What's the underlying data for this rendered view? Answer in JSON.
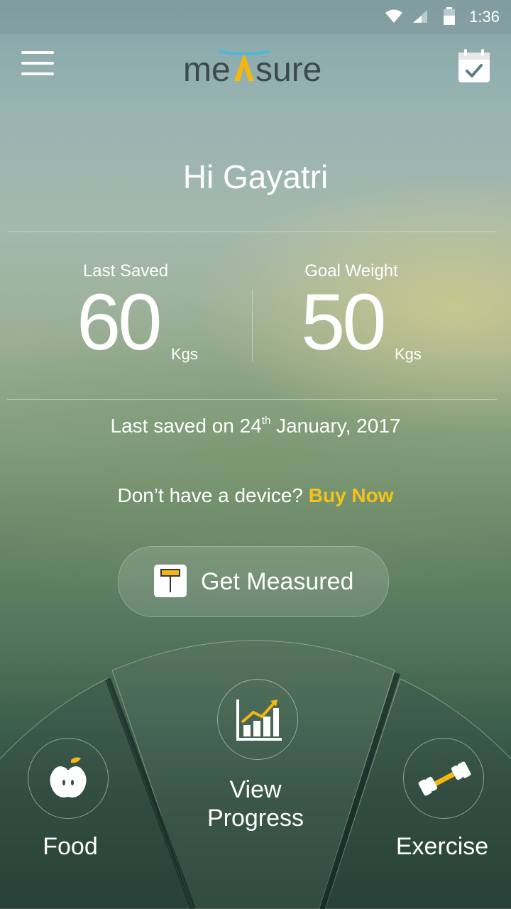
{
  "status_bar": {
    "time": "1:36"
  },
  "header": {
    "logo_text": "meAsure"
  },
  "greeting": "Hi Gayatri",
  "stats": {
    "last_saved": {
      "label": "Last Saved",
      "value": "60",
      "unit": "Kgs"
    },
    "goal_weight": {
      "label": "Goal Weight",
      "value": "50",
      "unit": "Kgs"
    }
  },
  "last_saved_date": {
    "prefix": "Last saved on 24",
    "sup": "th",
    "suffix": " January, 2017"
  },
  "device_prompt": {
    "text": "Don’t have a device? ",
    "link": "Buy Now"
  },
  "get_measured": {
    "label": "Get Measured"
  },
  "bottom_nav": {
    "food": {
      "label": "Food"
    },
    "progress": {
      "line1": "View",
      "line2": "Progress"
    },
    "exercise": {
      "label": "Exercise"
    }
  },
  "colors": {
    "accent": "#f6c21c",
    "logo_dark": "#3a4a4e",
    "logo_blue": "#4fb8d6"
  },
  "icons": [
    "wifi-icon",
    "signal-icon",
    "battery-icon",
    "menu-icon",
    "calendar-check-icon",
    "scale-icon",
    "apple-icon",
    "chart-growth-icon",
    "dumbbell-icon"
  ]
}
